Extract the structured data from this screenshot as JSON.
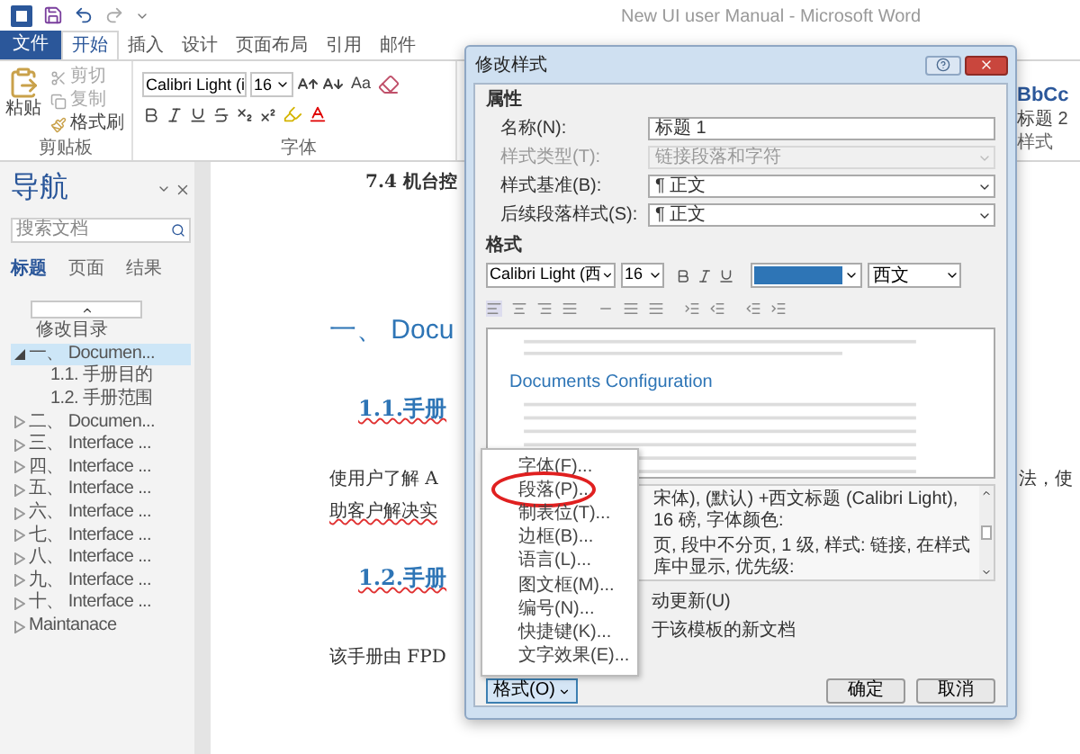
{
  "window": {
    "title": "New UI user Manual - Microsoft Word"
  },
  "ribbon_tabs": [
    {
      "label": "文件",
      "kind": "file",
      "selected": false
    },
    {
      "label": "开始",
      "kind": "tab",
      "selected": true
    },
    {
      "label": "插入",
      "kind": "tab",
      "selected": false
    },
    {
      "label": "设计",
      "kind": "tab",
      "selected": false
    },
    {
      "label": "页面布局",
      "kind": "tab",
      "selected": false
    },
    {
      "label": "引用",
      "kind": "tab",
      "selected": false
    },
    {
      "label": "邮件",
      "kind": "tab",
      "selected": false
    }
  ],
  "ribbon": {
    "clipboard": {
      "paste": "粘贴",
      "cut": "剪切",
      "copy": "复制",
      "format_painter": "格式刷",
      "group_label": "剪贴板"
    },
    "font": {
      "font_name": "Calibri Light (i",
      "font_size": "16",
      "change_case": "Aa",
      "group_label": "字体"
    },
    "styles": {
      "preview": "BbCc",
      "style_name": "标题 2",
      "group_label": "样式"
    }
  },
  "navigation": {
    "title": "导航",
    "search": {
      "placeholder": "搜索文档"
    },
    "tabs": [
      {
        "label": "标题",
        "selected": true
      },
      {
        "label": "页面",
        "selected": false
      },
      {
        "label": "结果",
        "selected": false
      }
    ],
    "top_entry": "修改目录",
    "tree": [
      {
        "label": "一、 Documen...",
        "expanded": true,
        "selected": true,
        "children": [
          {
            "label": "1.1. 手册目的",
            "selected": false
          },
          {
            "label": "1.2. 手册范围",
            "selected": false
          }
        ]
      },
      {
        "label": "二、 Documen...",
        "expanded": false,
        "selected": false
      },
      {
        "label": "三、 Interface ...",
        "expanded": false,
        "selected": false
      },
      {
        "label": "四、 Interface ...",
        "expanded": false,
        "selected": false
      },
      {
        "label": "五、 Interface ...",
        "expanded": false,
        "selected": false
      },
      {
        "label": "六、 Interface ...",
        "expanded": false,
        "selected": false
      },
      {
        "label": "七、 Interface ...",
        "expanded": false,
        "selected": false
      },
      {
        "label": "八、 Interface ...",
        "expanded": false,
        "selected": false
      },
      {
        "label": "九、 Interface ...",
        "expanded": false,
        "selected": false
      },
      {
        "label": "十、 Interface ...",
        "expanded": false,
        "selected": false
      },
      {
        "label": "Maintanace",
        "expanded": false,
        "selected": false
      }
    ]
  },
  "document": {
    "section_heading": "7.4 机台控",
    "chapter": "一、 Docu",
    "section_1": "1.1.手册",
    "para_line_1": "使用户了解 A",
    "para_line_1_right": "法，使",
    "para_line_2": "助客户解决实",
    "section_2": "1.2.手册",
    "para_2": "该手册由 FPD"
  },
  "dialog": {
    "title": "修改样式",
    "properties_label": "属性",
    "fields": [
      {
        "label": "名称(N):",
        "value": "标题 1",
        "kind": "text",
        "disabled": false
      },
      {
        "label": "样式类型(T):",
        "value": "链接段落和字符",
        "kind": "select",
        "disabled": true
      },
      {
        "label": "样式基准(B):",
        "value": "¶ 正文",
        "kind": "select",
        "disabled": false
      },
      {
        "label": "后续段落样式(S):",
        "value": "¶ 正文",
        "kind": "select",
        "disabled": false
      }
    ],
    "format_label": "格式",
    "font": "Calibri Light (西",
    "size": "16",
    "color": "#2e75b6",
    "script": "西文",
    "preview_heading": "Documents Configuration",
    "description_lines": [
      "宋体), (默认) +西文标题 (Calibri Light), 16 磅, 字体颜色:",
      "页, 段中不分页, 1 级, 样式: 链接, 在样式库中显示, 优先级:"
    ],
    "auto_update": "动更新(U)",
    "new_documents": "于该模板的新文档",
    "format_button": "格式(O)",
    "ok": "确定",
    "cancel": "取消"
  },
  "format_menu": [
    {
      "label": "字体(F)...",
      "circled": false
    },
    {
      "label": "段落(P)...",
      "circled": true
    },
    {
      "label": "制表位(T)...",
      "circled": false
    },
    {
      "label": "边框(B)...",
      "circled": false
    },
    {
      "label": "语言(L)...",
      "circled": false
    },
    {
      "label": "图文框(M)...",
      "circled": false
    },
    {
      "label": "编号(N)...",
      "circled": false
    },
    {
      "label": "快捷键(K)...",
      "circled": false
    },
    {
      "label": "文字效果(E)...",
      "circled": false
    }
  ]
}
